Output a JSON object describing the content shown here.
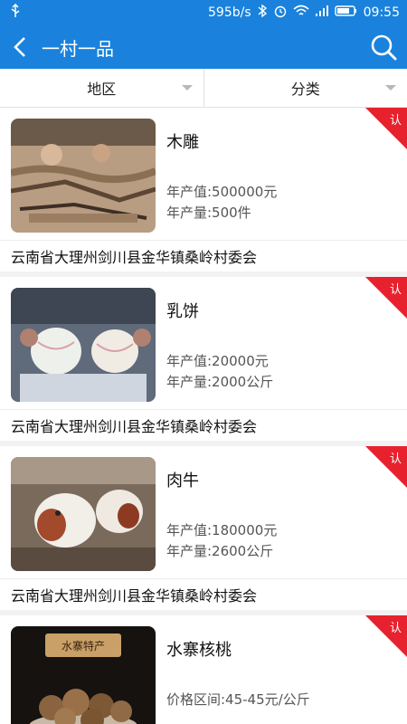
{
  "status": {
    "left_icon": "usb-icon",
    "speed": "595b/s",
    "time": "09:55"
  },
  "appbar": {
    "title": "一村一品"
  },
  "filters": [
    {
      "label": "地区"
    },
    {
      "label": "分类"
    }
  ],
  "items": [
    {
      "name": "木雕",
      "line1": "年产值:500000元",
      "line2": "年产量:500件",
      "location": "云南省大理州剑川县金华镇桑岭村委会",
      "badge": "认"
    },
    {
      "name": "乳饼",
      "line1": "年产值:20000元",
      "line2": "年产量:2000公斤",
      "location": "云南省大理州剑川县金华镇桑岭村委会",
      "badge": "认"
    },
    {
      "name": "肉牛",
      "line1": "年产值:180000元",
      "line2": "年产量:2600公斤",
      "location": "云南省大理州剑川县金华镇桑岭村委会",
      "badge": "认"
    },
    {
      "name": "水寨核桃",
      "line1": "价格区间:45-45元/公斤",
      "line2": "",
      "location": "",
      "badge": "认",
      "thumb_label": "水寨特产"
    }
  ],
  "colors": {
    "primary": "#1a82dc",
    "badge": "#e8212e"
  }
}
